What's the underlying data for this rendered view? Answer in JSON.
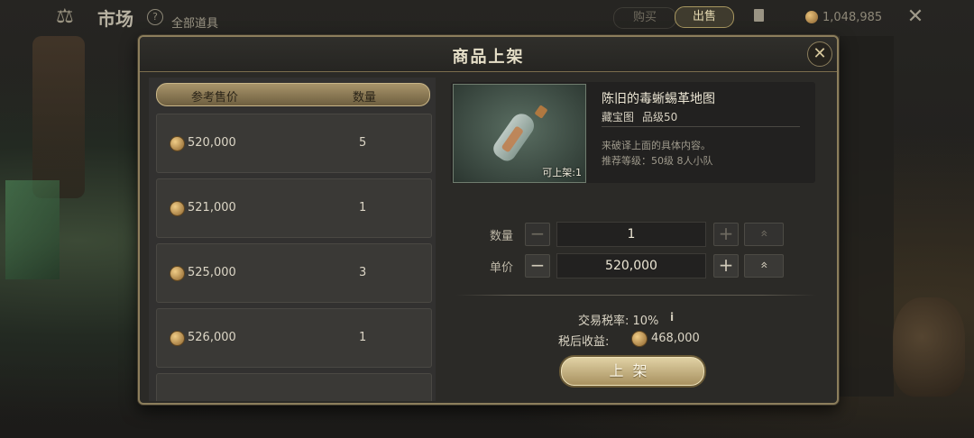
{
  "topbar": {
    "market_title": "市场",
    "help": "?",
    "filter_label": "全部道具",
    "buy_tab": "购买",
    "sell_tab": "出售",
    "gold": "1,048,985",
    "close_glyph": "✕"
  },
  "dialog": {
    "title": "商品上架",
    "close_glyph": "✕"
  },
  "listing_table": {
    "header_price": "参考售价",
    "header_qty": "数量",
    "rows": [
      {
        "price": "520,000",
        "qty": "5"
      },
      {
        "price": "521,000",
        "qty": "1"
      },
      {
        "price": "525,000",
        "qty": "3"
      },
      {
        "price": "526,000",
        "qty": "1"
      }
    ]
  },
  "item": {
    "name": "陈旧的毒蜥蜴革地图",
    "type": "藏宝图",
    "grade": "品级50",
    "description": "来破译上面的具体内容。",
    "recommended": "推荐等级：50级 8人小队",
    "listable": "可上架:1"
  },
  "form": {
    "qty_label": "数量",
    "qty_value": "1",
    "price_label": "单价",
    "price_value": "520,000",
    "minus": "−",
    "plus": "+",
    "max": "»"
  },
  "summary": {
    "tax_text": "交易税率:  10%",
    "info": "i",
    "income_label": "税后收益:",
    "income_value": "468,000"
  },
  "submit_label": "上架",
  "colors": {
    "gold_accent": "#c9b688",
    "panel_bg": "#2b2a27"
  }
}
